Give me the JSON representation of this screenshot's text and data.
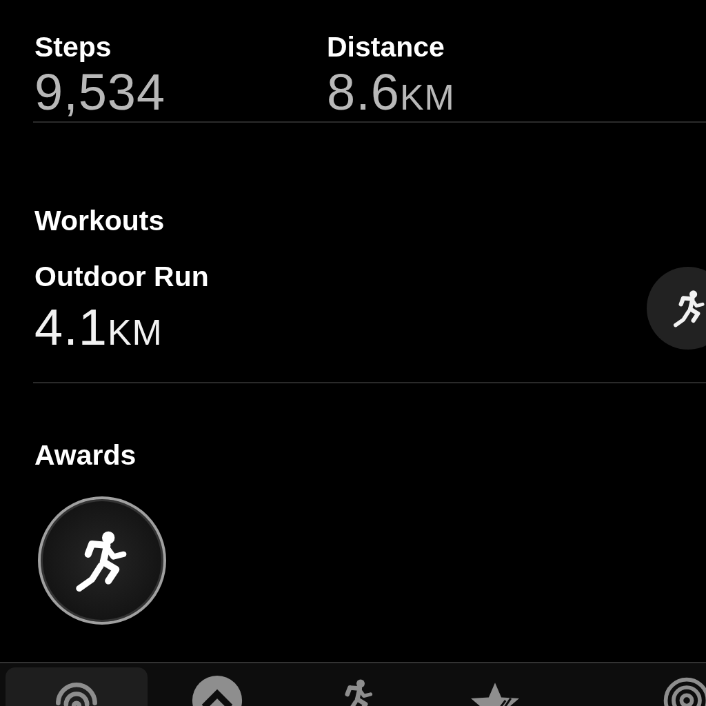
{
  "metrics": [
    {
      "label": "Steps",
      "value": "9,534"
    },
    {
      "label": "Distance",
      "value": "8.6",
      "unit": "KM"
    }
  ],
  "workouts": {
    "title": "Workouts",
    "items": [
      {
        "name": "Outdoor Run",
        "value": "4.1",
        "unit": "KM"
      }
    ]
  },
  "awards": {
    "title": "Awards",
    "items": [
      {
        "kind": "run"
      }
    ]
  },
  "tab_bar": [
    {
      "kind": "rings",
      "selected": true
    },
    {
      "kind": "arrow",
      "selected": false
    },
    {
      "kind": "run",
      "selected": false
    },
    {
      "kind": "star",
      "selected": false
    },
    {
      "kind": "spiral",
      "selected": false
    }
  ]
}
